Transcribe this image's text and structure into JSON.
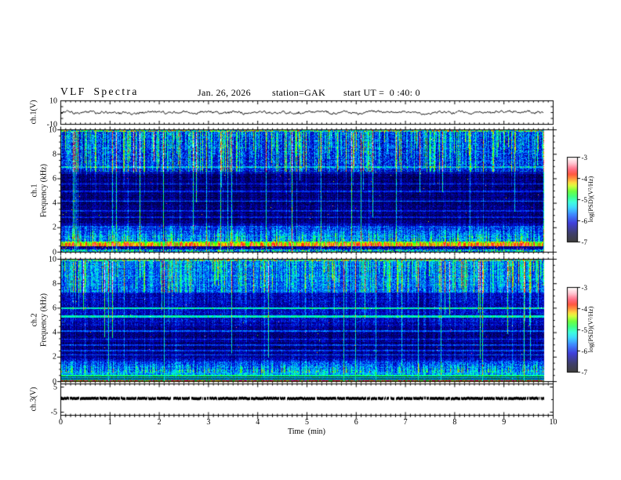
{
  "header": {
    "title": "VLF Spectra",
    "date": "Jan. 26, 2026",
    "station": "station=GAK",
    "start_ut": "start UT =  0 :40: 0"
  },
  "x_axis": {
    "label": "Time  (min)",
    "tick_labels": [
      "0",
      "1",
      "2",
      "3",
      "4",
      "5",
      "6",
      "7",
      "8",
      "9",
      "10"
    ],
    "lim_min": [
      0,
      10
    ],
    "data_end_min": 9.8
  },
  "chart_data": [
    {
      "type": "line",
      "panel": "ch1_waveform",
      "ylabel": "ch.1(V)",
      "ylim": [
        -10,
        10
      ],
      "ytick_labels": [
        "10",
        "-10"
      ],
      "description": "noisy black voltage trace fluctuating around 0 V, typical amplitude about ±2 V, spanning 0 to 9.8 min"
    },
    {
      "type": "heatmap",
      "panel": "ch1_spectrogram",
      "ylabel_line1": "ch.1",
      "ylabel_line2": "Frequency  (kHz)",
      "ylim_khz": [
        0,
        10
      ],
      "ytick_labels": [
        "10",
        "8",
        "6",
        "4",
        "2",
        "0"
      ],
      "colorbar": {
        "label": "log(PSD)(V²/Hz)",
        "tick_labels": [
          "-3",
          "-4",
          "-5",
          "-6",
          "-7"
        ],
        "range_log10_psd": [
          -7,
          -3
        ]
      },
      "features": {
        "background": "dark blue/black noise; brighter blue with dense vertical sferic streaks above about 6.5 kHz, some streaks spanning the full band",
        "horizontal_lines_khz": [
          7.0,
          6.5,
          5.6,
          5.0,
          4.2,
          3.4,
          2.9
        ],
        "hiss_band_khz": [
          0.9,
          2.2
        ],
        "yellow_green_line_khz": 0.85,
        "strong_orange_red_band_khz": [
          0.5,
          0.8
        ],
        "dark_speckled_band_khz": [
          0.25,
          0.5
        ],
        "green_mixed_band_khz": [
          0.0,
          0.25
        ]
      }
    },
    {
      "type": "heatmap",
      "panel": "ch2_spectrogram",
      "ylabel_line1": "ch.2",
      "ylabel_line2": "Frequency  (kHz)",
      "ylim_khz": [
        0,
        10
      ],
      "ytick_labels": [
        "10",
        "8",
        "6",
        "4",
        "2",
        "0"
      ],
      "colorbar": {
        "label": "log(PSD)(V²/Hz)",
        "tick_labels": [
          "-3",
          "-4",
          "-5",
          "-6",
          "-7"
        ],
        "range_log10_psd": [
          -7,
          -3
        ]
      },
      "features": {
        "background": "blue noise; brightest with dense vertical sferic streaks above about 7.3 kHz",
        "horizontal_lines_khz": [
          6.0,
          5.35,
          4.15,
          3.5,
          3.0,
          2.55,
          2.2
        ],
        "hiss_band_khz": [
          0.75,
          1.7
        ],
        "green_lines_khz": [
          0.52,
          0.36,
          0.22
        ],
        "red_line_khz": 0.1
      }
    },
    {
      "type": "line",
      "panel": "ch3_waveform",
      "ylabel": "ch.3(V)",
      "ylim": [
        -5,
        5
      ],
      "ytick_labels": [
        "5",
        "-5"
      ],
      "description": "flat thick black trace at 0 V spanning 0 to 9.8 min"
    }
  ],
  "colors": {
    "background": "#ffffff",
    "frame": "#000000",
    "trace": "#000000",
    "colormap_stops": [
      [
        0.0,
        "#000000"
      ],
      [
        0.1,
        "#000040"
      ],
      [
        0.22,
        "#0000d0"
      ],
      [
        0.32,
        "#0060ff"
      ],
      [
        0.4,
        "#00c8ff"
      ],
      [
        0.47,
        "#00ffd0"
      ],
      [
        0.53,
        "#00ff60"
      ],
      [
        0.6,
        "#40ff00"
      ],
      [
        0.66,
        "#c8ff00"
      ],
      [
        0.7,
        "#ffd000"
      ],
      [
        0.75,
        "#ff7000"
      ],
      [
        0.8,
        "#ff2000"
      ],
      [
        0.86,
        "#ff4060"
      ],
      [
        0.93,
        "#ffb0c0"
      ],
      [
        1.0,
        "#ffffff"
      ]
    ]
  }
}
